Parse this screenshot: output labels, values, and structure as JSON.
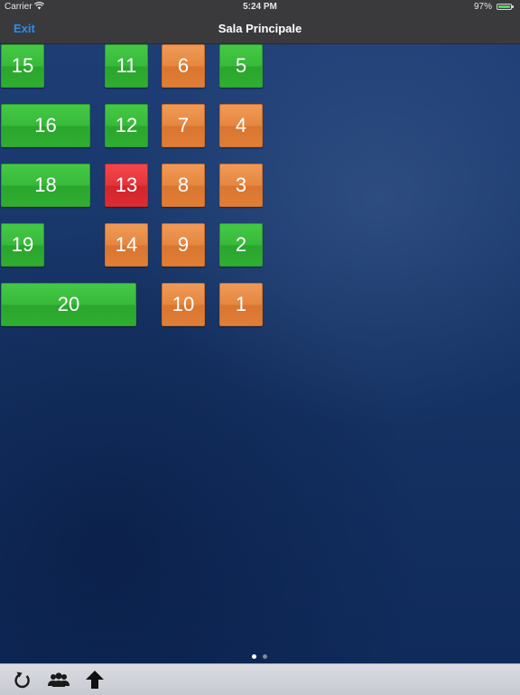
{
  "status_bar": {
    "carrier": "Carrier",
    "time": "5:24 PM",
    "battery_percent": "97%",
    "battery_level": 0.97
  },
  "nav_bar": {
    "exit_label": "Exit",
    "title": "Sala Principale"
  },
  "colors": {
    "free": "#3cbd3d",
    "busy": "#e4843c",
    "alert": "#e0353a",
    "accent": "#2f8ce8"
  },
  "tables": [
    {
      "number": "15",
      "status": "free"
    },
    {
      "number": "11",
      "status": "free"
    },
    {
      "number": "6",
      "status": "busy"
    },
    {
      "number": "5",
      "status": "free"
    },
    {
      "number": "16",
      "status": "free"
    },
    {
      "number": "12",
      "status": "free"
    },
    {
      "number": "7",
      "status": "busy"
    },
    {
      "number": "4",
      "status": "busy"
    },
    {
      "number": "18",
      "status": "free"
    },
    {
      "number": "13",
      "status": "alert"
    },
    {
      "number": "8",
      "status": "busy"
    },
    {
      "number": "3",
      "status": "busy"
    },
    {
      "number": "19",
      "status": "free"
    },
    {
      "number": "14",
      "status": "busy"
    },
    {
      "number": "9",
      "status": "busy"
    },
    {
      "number": "2",
      "status": "free"
    },
    {
      "number": "20",
      "status": "free"
    },
    {
      "number": "10",
      "status": "busy"
    },
    {
      "number": "1",
      "status": "busy"
    }
  ],
  "page_control": {
    "current_page": 1,
    "page_count": 2
  },
  "toolbar": {
    "icons": [
      "refresh-icon",
      "users-icon",
      "upload-arrow-icon"
    ]
  }
}
